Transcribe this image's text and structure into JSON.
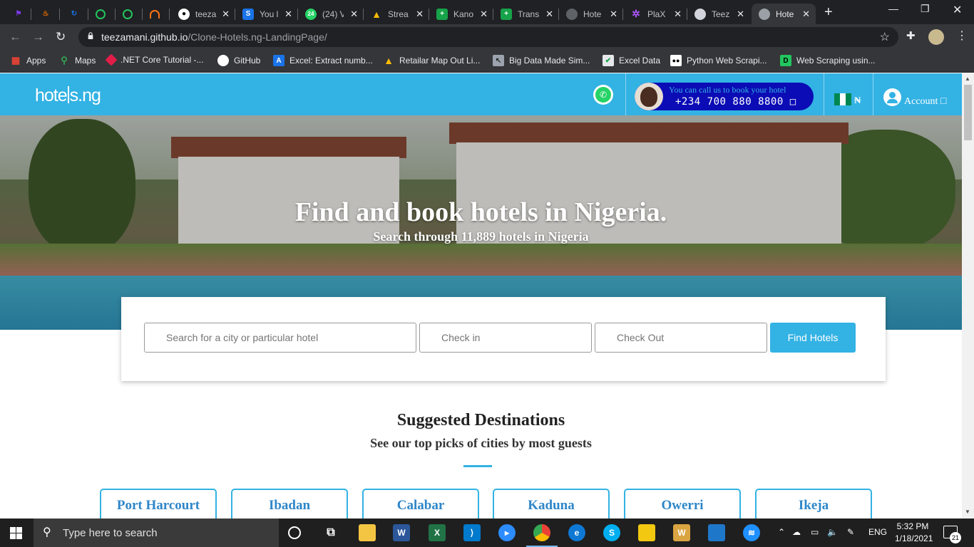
{
  "browser": {
    "tabs": [
      {
        "title": "",
        "icon": "purple-flag-icon",
        "color": "#7c3aed"
      },
      {
        "title": "",
        "icon": "java-icon",
        "color": "#e76f00"
      },
      {
        "title": "",
        "icon": "sync-icon",
        "color": "#1a73e8"
      },
      {
        "title": "",
        "icon": "green-ring-icon",
        "color": "#22c55e"
      },
      {
        "title": "",
        "icon": "green-ring-icon",
        "color": "#22c55e"
      },
      {
        "title": "",
        "icon": "orange-arch-icon",
        "color": "#f97316"
      },
      {
        "title": "teeza",
        "icon": "github-icon",
        "color": "#ffffff"
      },
      {
        "title": "You l",
        "icon": "s-icon",
        "color": "#1a73e8"
      },
      {
        "title": "(24) V",
        "icon": "whatsapp-icon",
        "color": "#25d366"
      },
      {
        "title": "Strea",
        "icon": "google-drive-icon",
        "color": "#fbbc04"
      },
      {
        "title": "Kano",
        "icon": "plus-sheet-icon",
        "color": "#16a34a"
      },
      {
        "title": "Trans",
        "icon": "plus-sheet-icon",
        "color": "#16a34a"
      },
      {
        "title": "Hote",
        "icon": "globe-icon",
        "color": "#9aa0a6"
      },
      {
        "title": "PlaX",
        "icon": "plax-icon",
        "color": "#a855f7"
      },
      {
        "title": "Teez",
        "icon": "avatar-icon",
        "color": "#d1d5db"
      },
      {
        "title": "Hote",
        "icon": "globe-icon",
        "color": "#9aa0a6",
        "active": true
      }
    ],
    "url_host": "teezamani.github.io",
    "url_path": "/Clone-Hotels.ng-LandingPage/",
    "bookmarks": [
      {
        "label": "Apps",
        "icon": "apps-grid-icon",
        "color": "#ea4335"
      },
      {
        "label": "Maps",
        "icon": "maps-pin-icon",
        "color": "#34a853"
      },
      {
        "label": ".NET Core Tutorial -...",
        "icon": "dotnet-icon",
        "color": "#e11d48"
      },
      {
        "label": "GitHub",
        "icon": "github-icon",
        "color": "#ffffff"
      },
      {
        "label": "Excel: Extract numb...",
        "icon": "a-icon",
        "color": "#1a73e8"
      },
      {
        "label": "Retailar Map Out Li...",
        "icon": "drive-icon",
        "color": "#fbbc04"
      },
      {
        "label": "Big Data Made Sim...",
        "icon": "cursor-icon",
        "color": "#9ca3af"
      },
      {
        "label": "Excel Data",
        "icon": "check-icon",
        "color": "#16a34a"
      },
      {
        "label": "Python Web Scrapi...",
        "icon": "medium-icon",
        "color": "#000000"
      },
      {
        "label": "Web Scraping usin...",
        "icon": "dc-icon",
        "color": "#22c55e"
      }
    ]
  },
  "site": {
    "logo": "hotels.ng",
    "call_line1": "You can call us to book your hotel",
    "call_line2": "+234  700  880  8800  □",
    "currency": "₦",
    "account_label": "Account □",
    "hero_title": "Find and book hotels in Nigeria.",
    "hero_subtitle": "Search through 11,889 hotels in Nigeria",
    "search_placeholder": "Search for a city or particular hotel",
    "checkin_placeholder": "Check in",
    "checkout_placeholder": "Check Out",
    "find_button": "Find Hotels",
    "dest_title": "Suggested Destinations",
    "dest_subtitle": "See our top picks of cities by most guests",
    "cities": [
      "Port Harcourt",
      "Ibadan",
      "Calabar",
      "Kaduna",
      "Owerri",
      "Ikeja"
    ],
    "accent_color": "#33b2e4"
  },
  "taskbar": {
    "search_placeholder": "Type here to search",
    "language": "ENG",
    "time": "5:32 PM",
    "date": "1/18/2021",
    "notification_count": "21"
  }
}
